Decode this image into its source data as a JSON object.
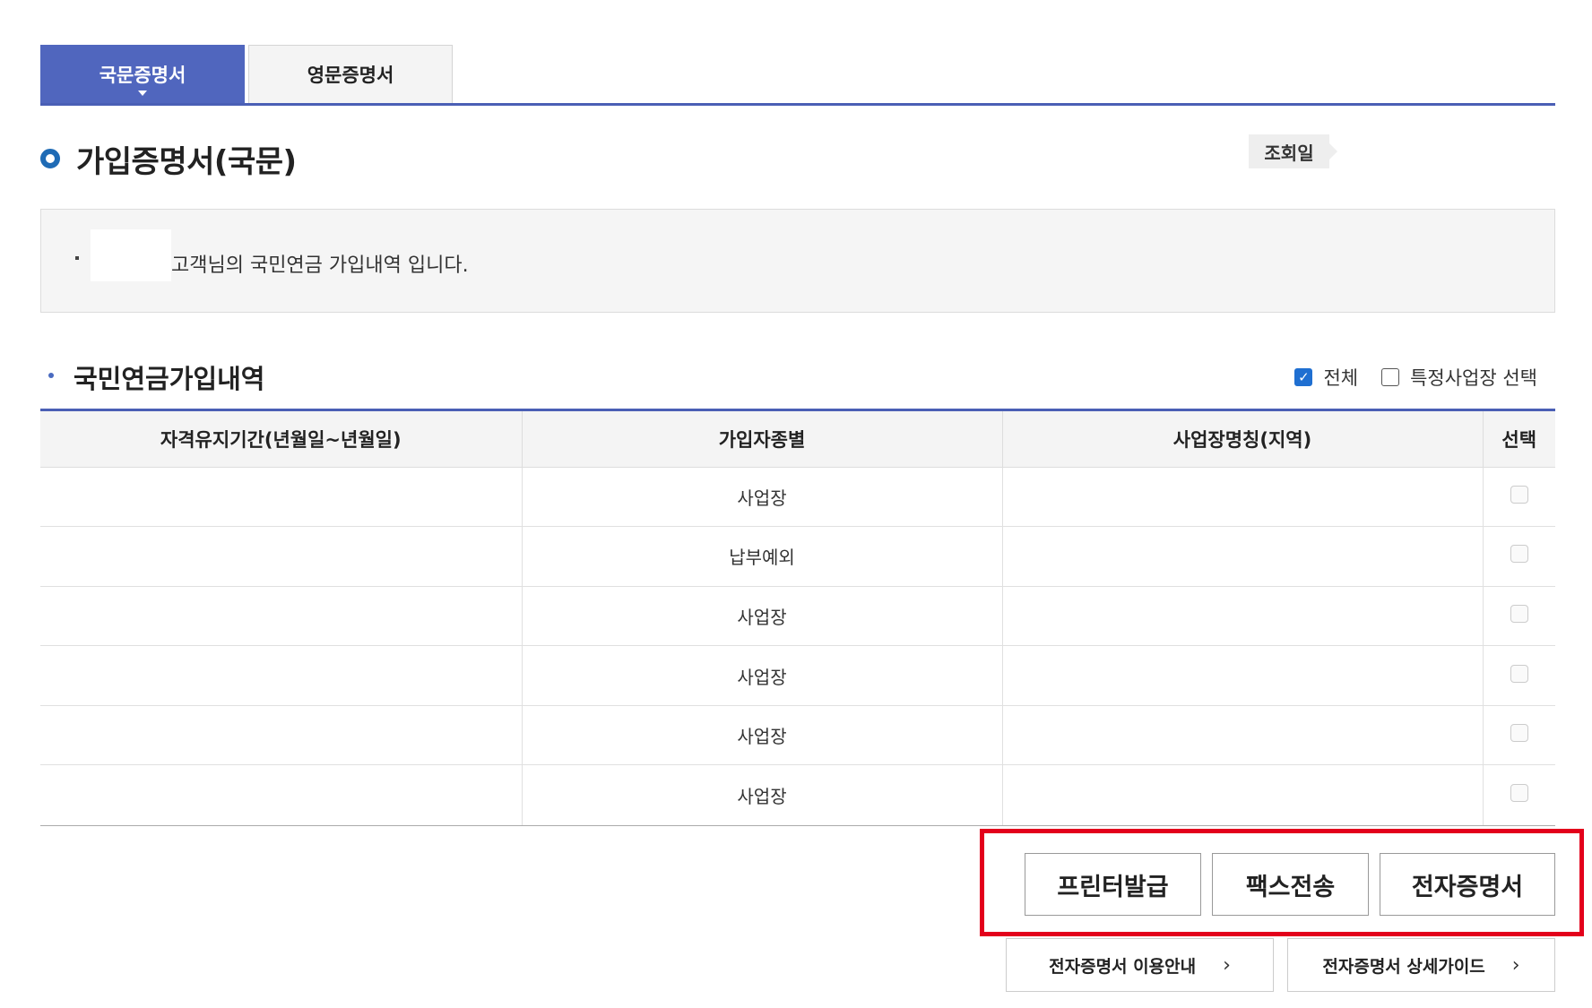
{
  "tabs": [
    {
      "label": "국문증명서",
      "active": true
    },
    {
      "label": "영문증명서",
      "active": false
    }
  ],
  "page": {
    "title": "가입증명서(국문)",
    "date_badge": "조회일"
  },
  "info": {
    "text": "고객님의 국민연금 가입내역 입니다."
  },
  "section": {
    "title": "국민연금가입내역",
    "filters": [
      {
        "label": "전체",
        "checked": true
      },
      {
        "label": "특정사업장 선택",
        "checked": false
      }
    ]
  },
  "table": {
    "headers": [
      "자격유지기간(년월일~년월일)",
      "가입자종별",
      "사업장명칭(지역)",
      "선택"
    ],
    "rows": [
      {
        "period": "",
        "type": "사업장",
        "workplace": "",
        "checked": false
      },
      {
        "period": "",
        "type": "납부예외",
        "workplace": "",
        "checked": false
      },
      {
        "period": "",
        "type": "사업장",
        "workplace": "",
        "checked": false
      },
      {
        "period": "",
        "type": "사업장",
        "workplace": "",
        "checked": false
      },
      {
        "period": "",
        "type": "사업장",
        "workplace": "",
        "checked": false
      },
      {
        "period": "",
        "type": "사업장",
        "workplace": "",
        "checked": false
      }
    ]
  },
  "actions": {
    "print": "프린터발급",
    "fax": "팩스전송",
    "ecert": "전자증명서"
  },
  "guides": {
    "usage": "전자증명서 이용안내",
    "detail": "전자증명서 상세가이드"
  },
  "colors": {
    "accent": "#4a5fb5",
    "tab_active": "#5066be",
    "highlight_frame": "#e3001b",
    "checkbox_checked": "#1f6fd1"
  }
}
